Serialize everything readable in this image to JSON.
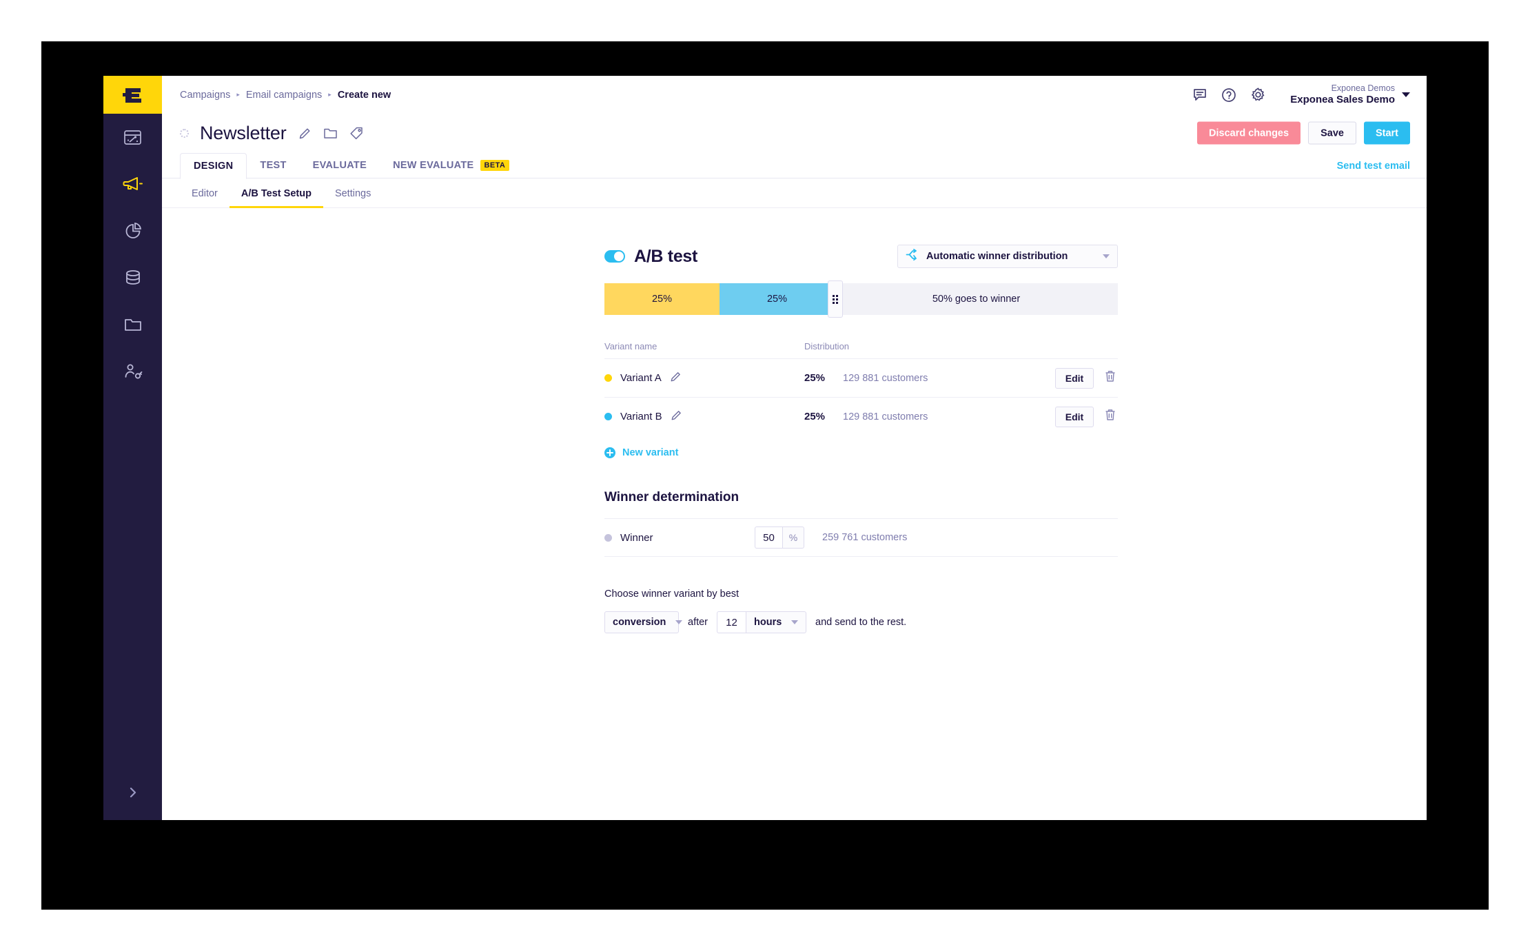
{
  "breadcrumb": {
    "items": [
      {
        "label": "Campaigns"
      },
      {
        "label": "Email campaigns"
      },
      {
        "label": "Create new"
      }
    ],
    "separator": "▸"
  },
  "header": {
    "icons": [
      "chat-icon",
      "help-icon",
      "gear-icon"
    ],
    "account_org": "Exponea Demos",
    "account_name": "Exponea Sales Demo"
  },
  "title_row": {
    "campaign_title": "Newsletter",
    "actions": [
      "edit-pencil-icon",
      "folder-icon",
      "tag-icon"
    ],
    "buttons": {
      "discard": "Discard changes",
      "save": "Save",
      "start": "Start"
    }
  },
  "tabs": {
    "items": [
      {
        "label": "DESIGN",
        "active": true,
        "badge": ""
      },
      {
        "label": "TEST",
        "active": false,
        "badge": ""
      },
      {
        "label": "EVALUATE",
        "active": false,
        "badge": ""
      },
      {
        "label": "NEW EVALUATE",
        "active": false,
        "badge": "BETA"
      }
    ],
    "send_test_email": "Send test email"
  },
  "subtabs": {
    "items": [
      {
        "label": "Editor",
        "active": false
      },
      {
        "label": "A/B Test Setup",
        "active": true
      },
      {
        "label": "Settings",
        "active": false
      }
    ]
  },
  "sidebar": {
    "logo": "exponea-logo",
    "items": [
      {
        "name": "sidebar-item-dashboards",
        "icon": "browser-window-icon",
        "active": false
      },
      {
        "name": "sidebar-item-campaigns",
        "icon": "megaphone-icon",
        "active": true
      },
      {
        "name": "sidebar-item-analytics",
        "icon": "pie-chart-icon",
        "active": false
      },
      {
        "name": "sidebar-item-data",
        "icon": "database-icon",
        "active": false
      },
      {
        "name": "sidebar-item-assets",
        "icon": "folder-icon",
        "active": false
      },
      {
        "name": "sidebar-item-customers",
        "icon": "user-key-icon",
        "active": false
      }
    ],
    "expand": "›"
  },
  "ab_test": {
    "toggle_on": true,
    "title": "A/B test",
    "distribution_mode": "Automatic winner distribution",
    "distribution_icon": "split-branch-icon",
    "bar": [
      {
        "name": "variant-a",
        "label": "25%",
        "percent": 25,
        "color": "#ffd75e"
      },
      {
        "name": "variant-b",
        "label": "25%",
        "percent": 25,
        "color": "#6ecdf0"
      },
      {
        "name": "winner",
        "label": "50% goes to winner",
        "percent": 50,
        "color": "#f2f2f7"
      }
    ],
    "table": {
      "headers": {
        "name": "Variant name",
        "distribution": "Distribution"
      },
      "rows": [
        {
          "dot_class": "a",
          "label": "Variant A",
          "percent": "25%",
          "customers": "129 881 customers",
          "edit": "Edit"
        },
        {
          "dot_class": "b",
          "label": "Variant B",
          "percent": "25%",
          "customers": "129 881 customers",
          "edit": "Edit"
        }
      ]
    },
    "new_variant": "New variant"
  },
  "winner": {
    "section_title": "Winner determination",
    "label": "Winner",
    "percent_value": "50",
    "percent_unit": "%",
    "customers": "259 761 customers",
    "choose_label": "Choose winner variant by best",
    "metric": "conversion",
    "after_word": "after",
    "duration_value": "12",
    "duration_unit": "hours",
    "rest_word": "and send to the rest."
  },
  "colors": {
    "brand_yellow": "#ffd60a",
    "brand_navy": "#221c40",
    "accent_blue": "#2bbdf0",
    "danger_pink": "#f98a98",
    "variant_a": "#ffd75e",
    "variant_b": "#6ecdf0",
    "winner_grey": "#f2f2f7"
  }
}
